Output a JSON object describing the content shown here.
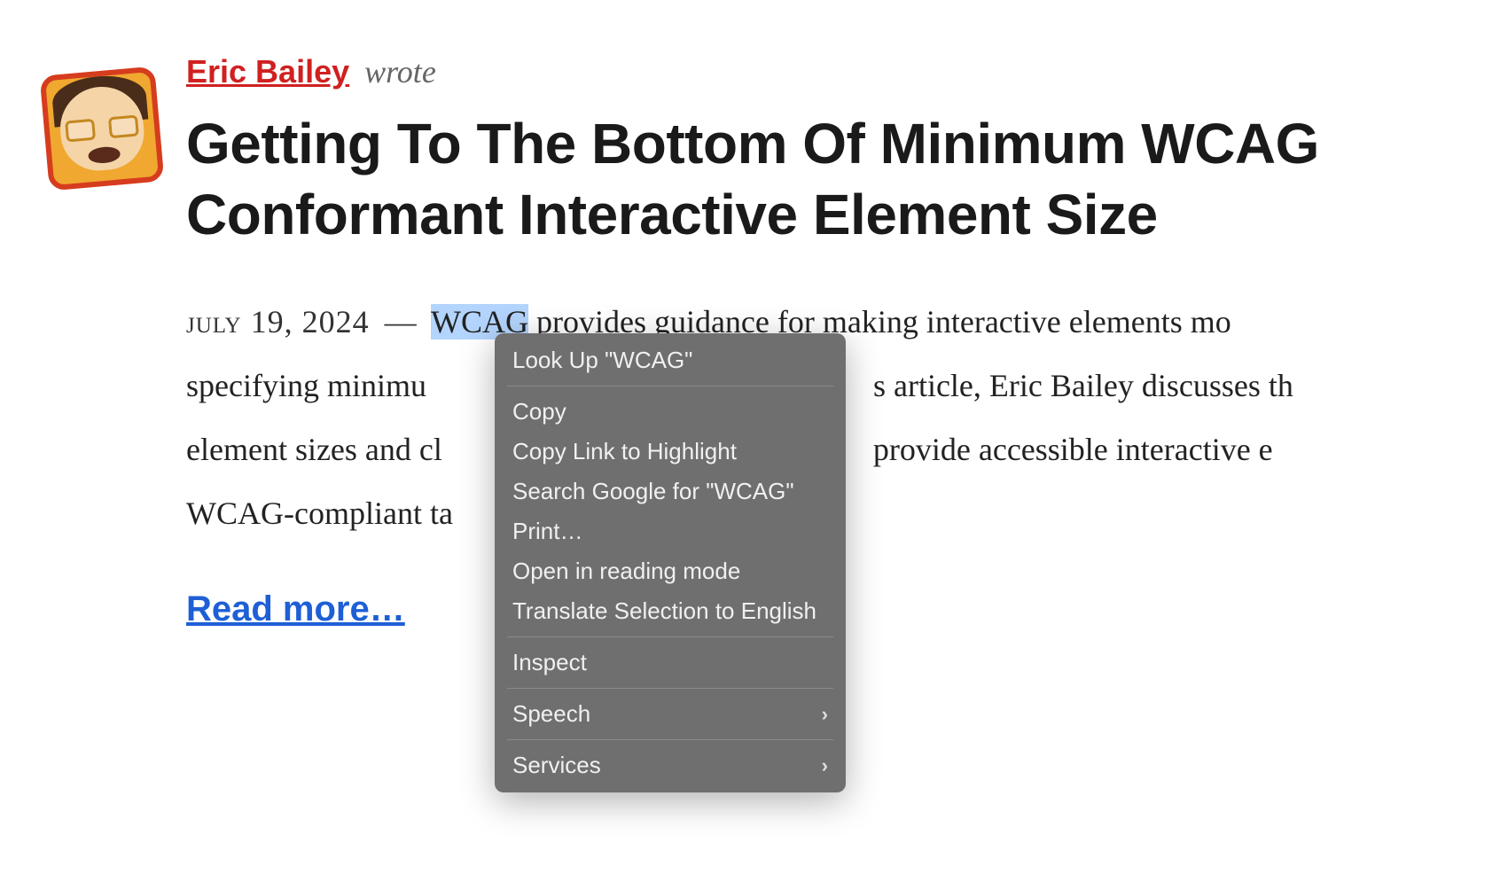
{
  "article": {
    "author_name": "Eric Bailey",
    "wrote_suffix": "wrote",
    "title_line1": "Getting To The Bottom Of Minimum WCAG",
    "title_line2": "Conformant Interactive Element Size",
    "date": "july 19, 2024",
    "dash": "—",
    "highlighted_word": "WCAG",
    "body_after_highlight": " provides guidance for making interactive elements mo",
    "body_line2_pre": "specifying minimu",
    "body_line2_post": "s article, Eric Bailey discusses th",
    "body_line3_pre": "element sizes and cl",
    "body_line3_post": "provide accessible interactive e",
    "body_line4": "WCAG-compliant ta",
    "read_more": "Read more…"
  },
  "context_menu": {
    "lookup": "Look Up \"WCAG\"",
    "copy": "Copy",
    "copy_link": "Copy Link to Highlight",
    "search": "Search Google for \"WCAG\"",
    "print": "Print…",
    "reading_mode": "Open in reading mode",
    "translate": "Translate Selection to English",
    "inspect": "Inspect",
    "speech": "Speech",
    "services": "Services"
  }
}
